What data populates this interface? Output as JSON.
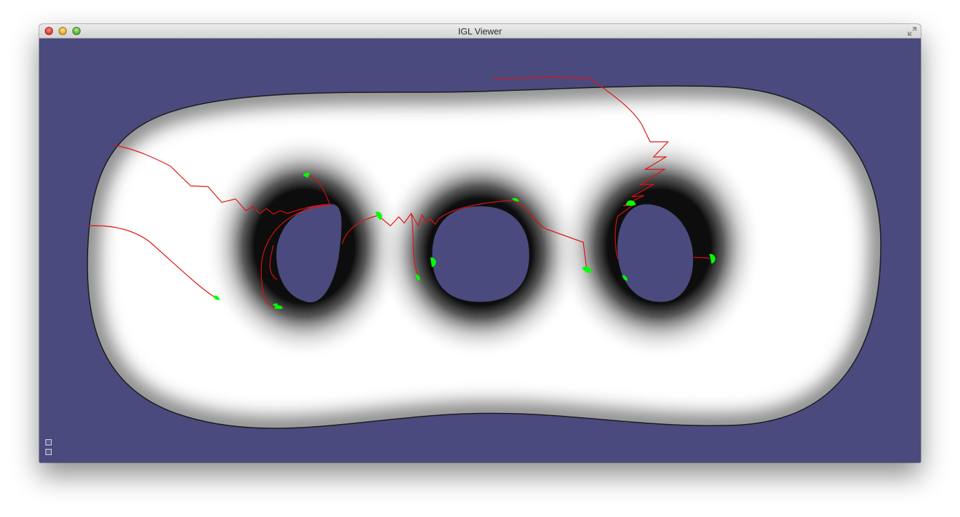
{
  "window": {
    "title": "IGL Viewer",
    "background_color": "#4b4a7e"
  },
  "titlebar": {
    "buttons": [
      "close-button",
      "minimize-button",
      "zoom-button"
    ],
    "fullscreen_icon": "fullscreen-icon"
  },
  "viewport": {
    "mesh": "triple-torus",
    "mesh_color": "#ffffff",
    "path_color": "#e01010",
    "marker_color": "#00ff00"
  },
  "corner_controls": [
    "widget-toggle-icon",
    "widget-panel-icon"
  ]
}
